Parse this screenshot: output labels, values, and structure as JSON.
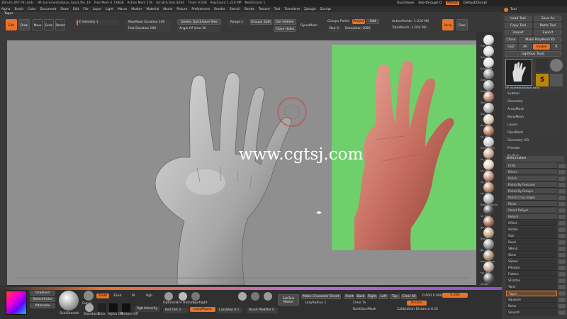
{
  "menubar": {
    "app": "ZBrush 4R7 P3 (x64)",
    "file": "HP_IncrementalSave_hand_file_19",
    "mem": "Free Mem 6.738GB",
    "active_mem": "Active Mem 578",
    "scratch": "Scratch Disk 8244",
    "timer": "Timer 0.038",
    "polycount": "PolyCount 1.216 MP",
    "meshcount": "MeshCount 1",
    "menus": [
      "Alpha",
      "Brush",
      "Color",
      "Document",
      "Draw",
      "Edit",
      "File",
      "Layer",
      "Light",
      "Macro",
      "Marker",
      "Material",
      "Movie",
      "Picture",
      "Preferences",
      "Render",
      "Stencil",
      "Stroke",
      "Texture",
      "Tool",
      "Transform",
      "Zplugin",
      "Zscript"
    ],
    "quicksave": "QuickSave",
    "seethrough": "See-through 0",
    "menus_btn": "Menus",
    "default_zscript": "DefaultZScript"
  },
  "tool_title": "Taper",
  "shelf": {
    "edit": "Edit",
    "draw": "Draw",
    "move": "Move",
    "scale": "Scale",
    "rotate": "Rotate",
    "intensity": "Z Intensity 1",
    "maxmean": "MaxMean Duration 100",
    "fast_duration": "Fast Duration 100",
    "delete_quicksave": "Delete QuickSave files",
    "angle_of_view": "Angle Of View 30",
    "range": "Range 1",
    "groups_split": "Groups Split",
    "del_hidden": "Del Hidden",
    "close_holes": "Close Holes",
    "dyna_mesh": "DynaMesh",
    "groups": "Groups",
    "polish": "Polish",
    "project": "Project",
    "add": "Add",
    "blur": "Blur 0",
    "resolution": "Resolution 1080",
    "active_points": "ActivePoints: 1.216 Mil",
    "total_points": "TotalPoints: 2.054 Mil",
    "persp": "Persp",
    "floor": "Floor"
  },
  "watermark": "www.cgtsj.com",
  "rail_materials": [
    "Flat Color",
    "Seg",
    "BasicMat",
    "Gray",
    "Droplet",
    "Skin",
    "Silo",
    "dt_basic",
    "sp_skin",
    "ShinyMetal",
    "sk_clay",
    "sk_wax",
    "sk_skin",
    "sk_zbru",
    "BasicMaterial",
    "sk_dark",
    "gb_skin",
    "Skin2",
    "gb_vari",
    "mah_creep",
    "tsv_soft",
    "ZEdge"
  ],
  "panel": {
    "tool": "Tool",
    "load_tool": "Load Tool",
    "save_as": "Save As",
    "copy_tool": "Copy Tool",
    "paste_tool": "Paste Tool",
    "import": "Import",
    "export": "Export",
    "clone": "Clone",
    "make_polymesh": "Make PolyMesh3D",
    "goz": "GoZ",
    "all": "All",
    "visible": "Visible",
    "r": "R",
    "lightbox_tools": "Lightbox Tools",
    "hp_label": "HP_IncrementalSave_hand",
    "thumb_count": "5",
    "subtool": "Subtool",
    "geometry": "Geometry",
    "arraymesh": "ArrayMesh",
    "nanomesh": "NanoMesh",
    "layers": "Layers",
    "fibermesh": "FiberMesh",
    "geometry_hd": "Geometry HD",
    "preview": "Preview",
    "surface": "Surface",
    "deformation": "Deformation",
    "unify": "Unify",
    "mirror": "Mirror",
    "polish": "Polish",
    "polish_features": "Polish By Features",
    "polish_groups": "Polish By Groups",
    "polish_crisp": "Polish Crisp Edges",
    "relax": "Relax",
    "smart_relym": "Smart ReSym",
    "relym": "ReSym",
    "sliders": [
      "Offset",
      "Rotate",
      "Size",
      "Bend",
      "SBend",
      "Skew",
      "SSkew",
      "FRotate",
      "Flatten",
      "SFlatten",
      "Twist",
      "Taper",
      "Squeeze",
      "Noise",
      "Smooth",
      "Inflate"
    ]
  },
  "bottom": {
    "gradient": "Gradient",
    "switch_color": "SwitchColor",
    "alternate": "Alternate",
    "zadd": "Zadd",
    "zsub": "Zsub",
    "m": "M",
    "rgb": "Rgb",
    "mrgb": "Mrgb",
    "rgb_intensity": "Rgb Intensity",
    "curve": "Curve",
    "standard": "Standard",
    "dots": "Dots",
    "alpha_off": "Alpha Off",
    "texture_off": "Texture Off",
    "skindshade": "SkinShade4",
    "draw_size": "Draw Size 64",
    "dynamic": "Dynamic",
    "roll_dist": "Roll Dist 2",
    "lazymouse": "LazyMouse",
    "lazystep": "LazyStep 0.1",
    "lazyradius": "LazyRadius 1",
    "lazysmooth": "LazySmooth 1",
    "optimize": "Optimize",
    "uv_unfold": "UV Unfold",
    "spotlight": "Spotlight",
    "brush_modifier": "Brush Modifier 0",
    "subtool_master": "SubTool Master",
    "make_character_sheet": "Make Character Sheet",
    "front": "Front",
    "back": "Back",
    "right": "Right",
    "left": "Left",
    "top": "Top",
    "bottom_v": "Bottom",
    "clear_all": "Clear All",
    "clear_to": "Clear To",
    "backface_mask": "BackfaceMask",
    "double": "Double",
    "calibration": "Calibration Distance 0.25",
    "gizmo_vals": "0.000   0.000",
    "gizmo_vals2": "0.000"
  },
  "colors": {
    "accent": "#e8722a",
    "canvas": "#8f8f8f",
    "photo_bg": "#6fcf6a",
    "brush_ring": "#c0504d"
  }
}
